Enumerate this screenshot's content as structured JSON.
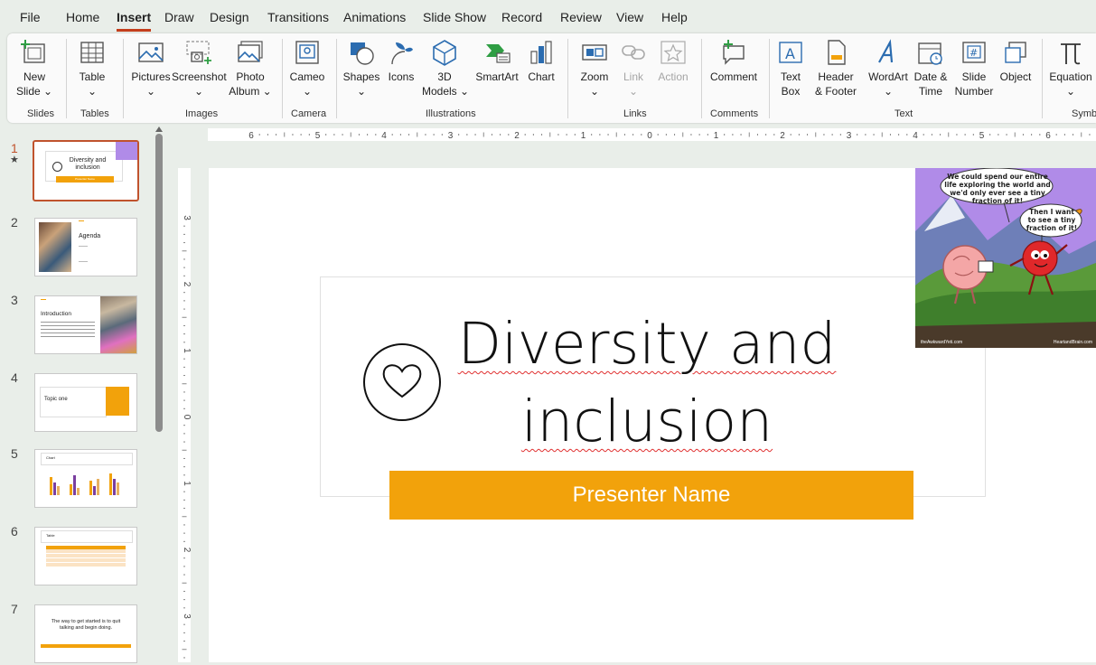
{
  "menu": {
    "tabs": [
      "File",
      "Home",
      "Insert",
      "Draw",
      "Design",
      "Transitions",
      "Animations",
      "Slide Show",
      "Record",
      "Review",
      "View",
      "Help"
    ],
    "active_tab": "Insert"
  },
  "ribbon": {
    "new_slide": {
      "line1": "New",
      "line2": "Slide ⌄"
    },
    "table": {
      "line1": "Table",
      "line2": "⌄"
    },
    "pictures": {
      "line1": "Pictures",
      "line2": "⌄"
    },
    "screenshot": {
      "line1": "Screenshot",
      "line2": "⌄"
    },
    "photo_album": {
      "line1": "Photo",
      "line2": "Album ⌄"
    },
    "cameo": {
      "line1": "Cameo",
      "line2": "⌄"
    },
    "shapes": {
      "line1": "Shapes",
      "line2": "⌄"
    },
    "icons": {
      "line1": "Icons"
    },
    "models_3d": {
      "line1": "3D",
      "line2": "Models ⌄"
    },
    "smartart": {
      "line1": "SmartArt"
    },
    "chart": {
      "line1": "Chart"
    },
    "zoom": {
      "line1": "Zoom",
      "line2": "⌄"
    },
    "link": {
      "line1": "Link",
      "line2": "⌄"
    },
    "action": {
      "line1": "Action"
    },
    "comment": {
      "line1": "Comment"
    },
    "text_box": {
      "line1": "Text",
      "line2": "Box"
    },
    "header_footer": {
      "line1": "Header",
      "line2": "& Footer"
    },
    "wordart": {
      "line1": "WordArt",
      "line2": "⌄"
    },
    "date_time": {
      "line1": "Date &",
      "line2": "Time"
    },
    "slide_number": {
      "line1": "Slide",
      "line2": "Number"
    },
    "object": {
      "line1": "Object"
    },
    "equation": {
      "line1": "Equation",
      "line2": "⌄"
    },
    "groups": {
      "slides": "Slides",
      "tables": "Tables",
      "images": "Images",
      "camera": "Camera",
      "illustrations": "Illustrations",
      "links": "Links",
      "comments": "Comments",
      "text": "Text",
      "symbols": "Symb"
    }
  },
  "rulers": {
    "horizontal": [
      "6",
      "5",
      "4",
      "3",
      "2",
      "1",
      "0",
      "1",
      "2",
      "3",
      "4",
      "5",
      "6"
    ],
    "vertical": [
      "3",
      "2",
      "1",
      "0",
      "1",
      "2",
      "3"
    ]
  },
  "thumbnails": [
    {
      "num": "1",
      "star": "★",
      "title": "Diversity and inclusion",
      "subtitle": "Presenter Name"
    },
    {
      "num": "2",
      "title": "Agenda"
    },
    {
      "num": "3",
      "title": "Introduction"
    },
    {
      "num": "4",
      "title": "Topic one"
    },
    {
      "num": "5",
      "title": "Chart"
    },
    {
      "num": "6",
      "title": "Table"
    },
    {
      "num": "7",
      "title": "The way to get started is to quit talking and begin doing."
    }
  ],
  "slide": {
    "title_line1": "Diversity and",
    "title_line2": "inclusion",
    "presenter": "Presenter Name",
    "comic": {
      "bubble1": "We could spend our entire life exploring the world and we'd only ever see a tiny fraction of it!",
      "bubble2": "Then I want to see a tiny fraction of it!",
      "credit_left": "theAwkwardYeti.com",
      "credit_right": "HeartandBrain.com"
    }
  },
  "colors": {
    "accent": "#f2a20b",
    "selection": "#c0532d",
    "ribbon_bg": "#fafafa",
    "app_bg": "#e9eee9",
    "comic_sky": "#b08be8"
  }
}
